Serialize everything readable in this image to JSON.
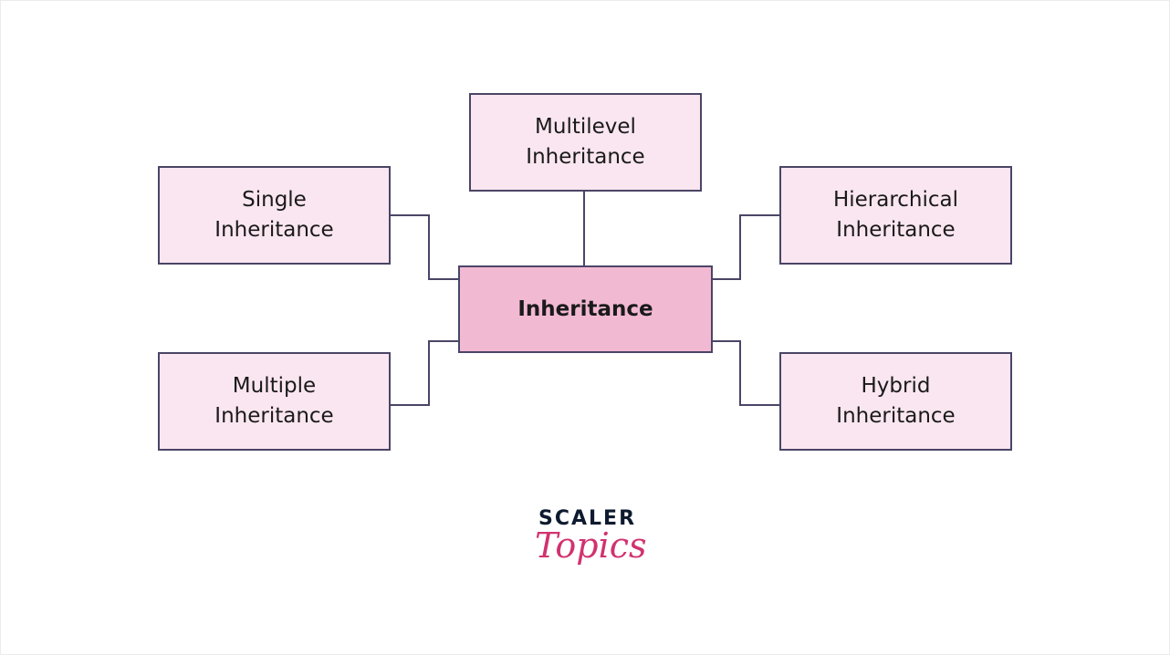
{
  "diagram": {
    "center": "Inheritance",
    "nodes": {
      "multilevel": "Multilevel\nInheritance",
      "single": "Single\nInheritance",
      "hierarchical": "Hierarchical\nInheritance",
      "multiple": "Multiple\nInheritance",
      "hybrid": "Hybrid\nInheritance"
    },
    "colors": {
      "node_fill": "#fae6f0",
      "center_fill": "#f2b9d3",
      "border": "#4a4566"
    }
  },
  "logo": {
    "line1": "SCALER",
    "line2": "Topics"
  }
}
